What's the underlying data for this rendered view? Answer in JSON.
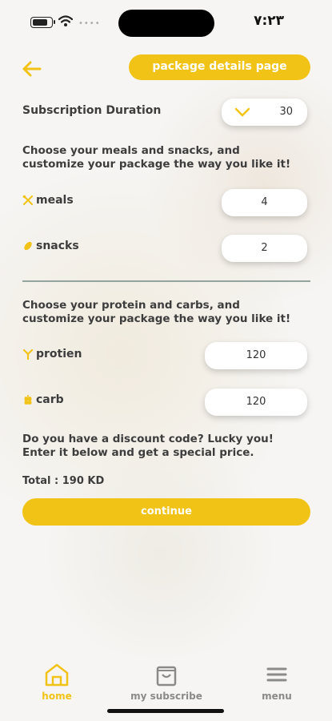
{
  "status": {
    "time": "٧:٢٣"
  },
  "header": {
    "title": "package details page"
  },
  "duration": {
    "label": "Subscription Duration",
    "value": "30"
  },
  "intro_meals": "Choose your meals and snacks, and customize your package the way you like it!",
  "meals": {
    "label": "meals",
    "value": "4"
  },
  "snacks": {
    "label": "snacks",
    "value": "2"
  },
  "intro_macros": "Choose your protein and carbs, and customize your package the way you like it!",
  "protein": {
    "label": "protien",
    "value": "120"
  },
  "carb": {
    "label": "carb",
    "value": "120"
  },
  "discount_text": "Do you have a discount code? Lucky you! Enter it below and get a special price.",
  "total": "Total : 190 KD",
  "continue_label": "continue",
  "tabs": {
    "home": "home",
    "subscribe": "my subscribe",
    "menu": "menu"
  },
  "colors": {
    "accent": "#f2c317",
    "divider": "#93a39d",
    "inactive": "#8a8a8a"
  }
}
